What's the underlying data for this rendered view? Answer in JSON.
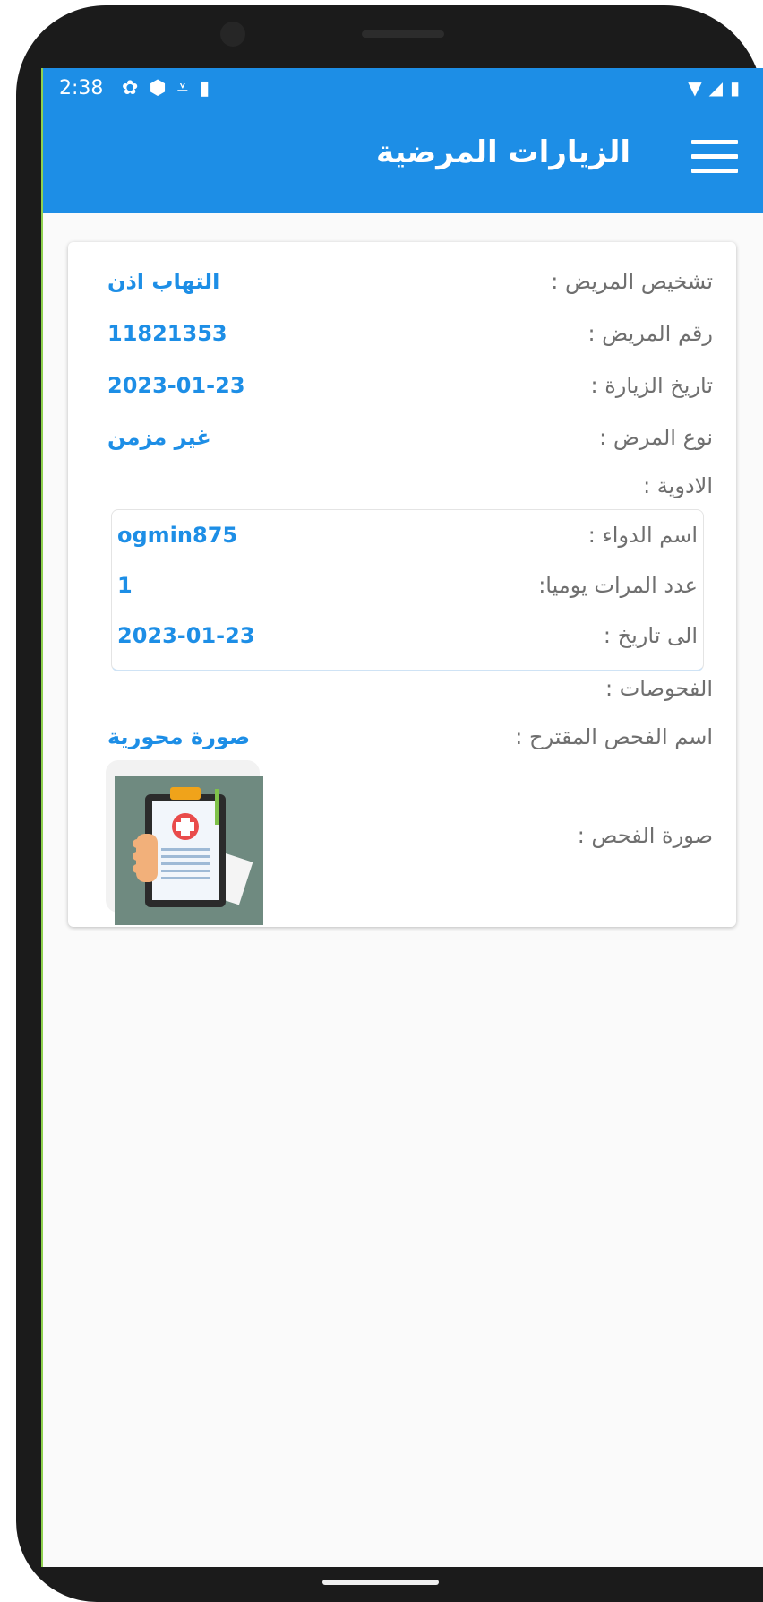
{
  "status_bar": {
    "time": "2:38",
    "left_icons": [
      "gear-icon",
      "shield-icon",
      "download-done-icon",
      "sd-card-icon"
    ],
    "right_icons": [
      "wifi-icon",
      "signal-icon",
      "battery-icon"
    ]
  },
  "app_bar": {
    "title": "الزيارات المرضية",
    "menu_icon": "hamburger-menu-icon",
    "color": "#1d8ee6"
  },
  "visit": {
    "diagnosis_label": "تشخيص المريض :",
    "diagnosis_value": "التهاب اذن",
    "patient_number_label": "رقم المريض :",
    "patient_number_value": "11821353",
    "visit_date_label": "تاريخ الزيارة :",
    "visit_date_value": "2023-01-23",
    "disease_type_label": "نوع المرض :",
    "disease_type_value": "غير مزمن",
    "medicines_label": "الادوية :",
    "medicine": {
      "name_label": "اسم الدواء :",
      "name_value": "ogmin875",
      "times_label": "عدد المرات يوميا:",
      "times_value": "1",
      "until_label": "الى تاريخ :",
      "until_value": "2023-01-23"
    },
    "exams_label": "الفحوصات :",
    "exam_name_label": "اسم الفحص المقترح :",
    "exam_name_value": "صورة محورية",
    "exam_image_label": "صورة الفحص :",
    "exam_image_icon": "medical-clipboard-icon"
  }
}
